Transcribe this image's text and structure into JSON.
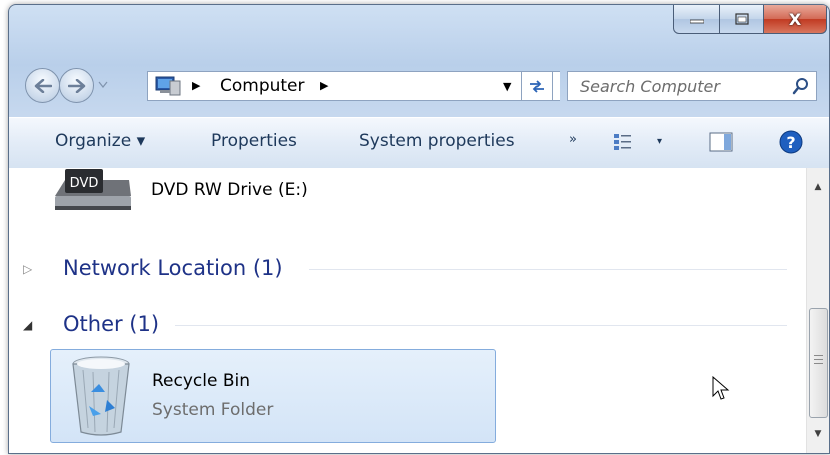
{
  "window": {
    "caption_buttons": {
      "minimize": "minimize",
      "maximize": "maximize",
      "close": "X"
    }
  },
  "address_bar": {
    "location_icon": "computer-icon",
    "breadcrumb": "Computer",
    "search_placeholder": "Search Computer"
  },
  "command_bar": {
    "organize": "Organize ▾",
    "properties": "Properties",
    "system_properties": "System properties",
    "more": "»",
    "views_dropdown": "▾"
  },
  "content": {
    "dvd_drive": {
      "name": "DVD RW Drive (E:)",
      "icon_label": "DVD"
    },
    "groups": [
      {
        "title": "Network Location (1)",
        "expanded": false
      },
      {
        "title": "Other (1)",
        "expanded": true
      }
    ],
    "items": [
      {
        "name": "Recycle Bin",
        "type": "System Folder",
        "icon": "recycle-bin-icon"
      }
    ]
  },
  "colors": {
    "group_header": "#1e3287",
    "selection_border": "#84acdd",
    "selection_fill": "#dce9f8",
    "close_button": "#c13a22"
  }
}
